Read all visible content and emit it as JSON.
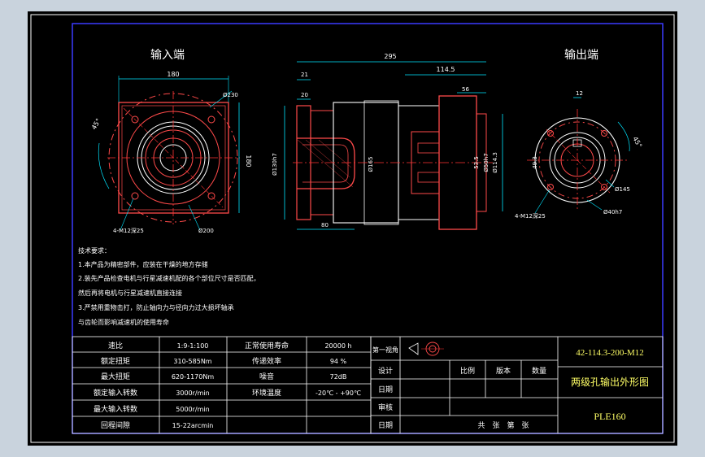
{
  "colors": {
    "window_bg": "#c9d3dd",
    "canvas": "#000000",
    "border": "#2f2fff",
    "outline": "#ff4a4a",
    "center_line": "#ff3333",
    "dim": "#00e5ff",
    "text": "#ffffff",
    "title_text": "#ffff66"
  },
  "views": {
    "input_label": "输入端",
    "output_label": "输出端"
  },
  "dims": {
    "d180_top": "180",
    "d180_side": "180",
    "d230": "Ø230",
    "d200": "Ø200",
    "ang45_left": "45°",
    "holes_left": "4-M12深25",
    "d295": "295",
    "d114_5": "114.5",
    "d56": "56",
    "d21": "21",
    "d20": "20",
    "d80": "80",
    "d130h7": "Ø130h7",
    "d165": "Ø165",
    "d114_3": "Ø114.3",
    "d50h7": "Ø50h7",
    "d53_5": "53.5",
    "d12": "12",
    "d49_3": "49.3",
    "ang45_right": "45°",
    "d145": "Ø145",
    "d40h7": "Ø40h7",
    "holes_right": "4-M12深25"
  },
  "notes": [
    "技术要求：",
    "1.本产品为精密部件，应装在干燥的地方存储",
    "2.装先产品检查电机与行星减速机配的各个部位尺寸是否匹配，",
    "然后再将电机与行星减速机直接连接",
    "3.严禁用重物击打，防止轴向力与径向力过大损坏轴承",
    "与齿轮而影响减速机的使用寿命"
  ],
  "specs": [
    {
      "l1": "速比",
      "v1": "1:9-1:100",
      "l2": "正常使用寿命",
      "v2": "20000 h"
    },
    {
      "l1": "额定扭矩",
      "v1": "310-585Nm",
      "l2": "传递效率",
      "v2": "94 %"
    },
    {
      "l1": "最大扭矩",
      "v1": "620-1170Nm",
      "l2": "噪音",
      "v2": "72dB"
    },
    {
      "l1": "额定输入转数",
      "v1": "3000r/min",
      "l2": "环境温度",
      "v2": "-20℃ - +90℃"
    },
    {
      "l1": "最大输入转数",
      "v1": "5000r/min",
      "l2": "",
      "v2": ""
    },
    {
      "l1": "回程间隙",
      "v1": "15-22arcmin",
      "l2": "",
      "v2": ""
    }
  ],
  "title_block": {
    "proj_label": "第一视角",
    "rows": [
      "设计",
      "日期",
      "审核",
      "日期"
    ],
    "scale": "比例",
    "version": "版本",
    "qty": "数量",
    "sheets": "共　张　第　张",
    "part_no": "42-114.3-200-M12",
    "part_name": "两级孔输出外形图",
    "model": "PLE160"
  }
}
